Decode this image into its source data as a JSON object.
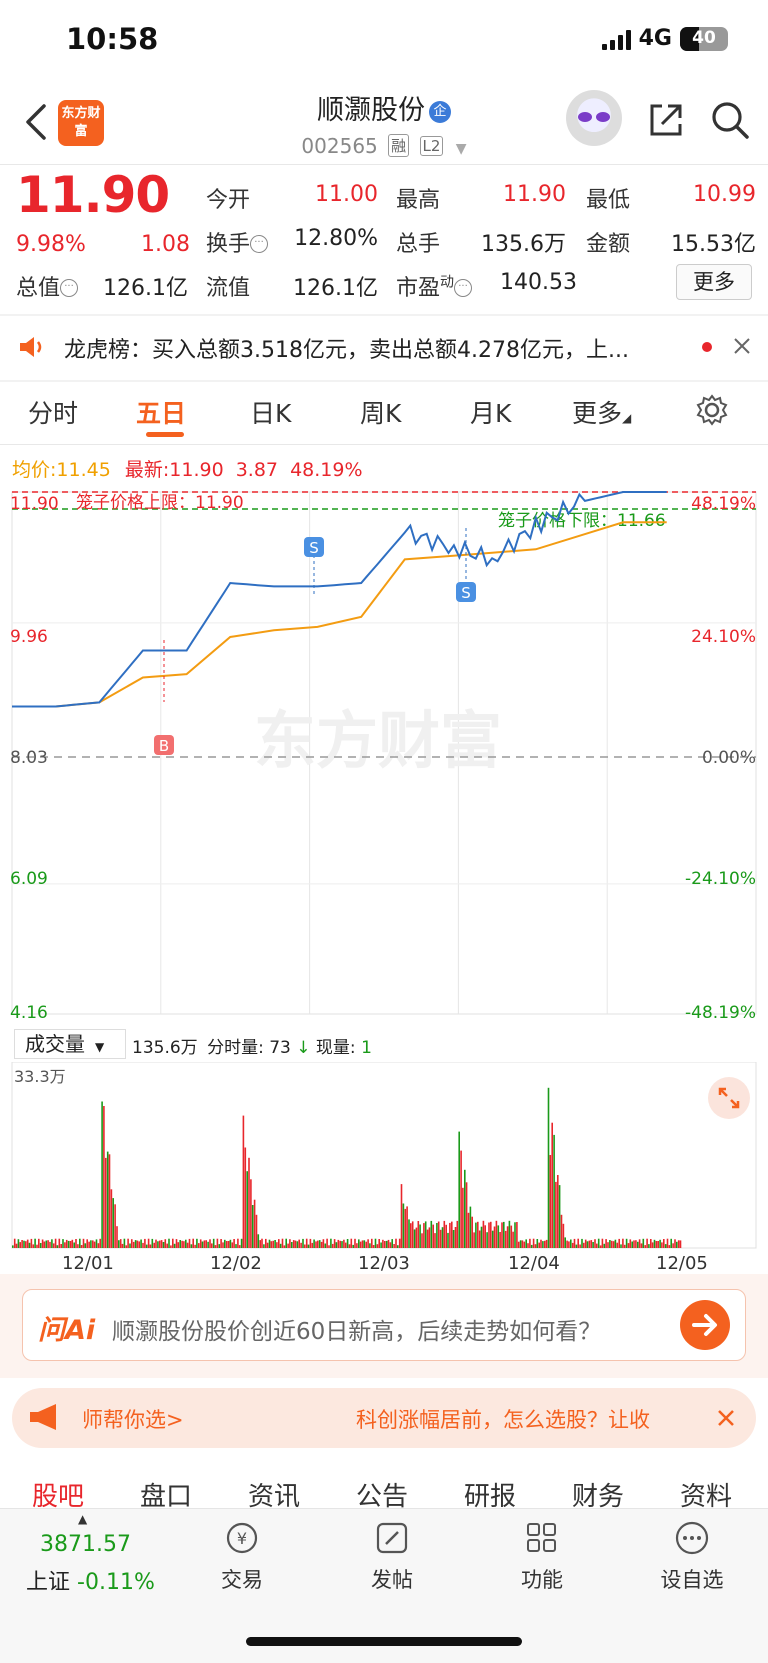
{
  "status": {
    "time": "10:58",
    "network": "4G",
    "battery": "40"
  },
  "header": {
    "logo": "东方财富",
    "stock_name": "顺灏股份",
    "cert_badge": "企",
    "stock_code": "002565",
    "tag_margin": "融",
    "tag_level": "L2"
  },
  "quote": {
    "price": "11.90",
    "change_pct": "9.98%",
    "change_amt": "1.08",
    "open_label": "今开",
    "open": "11.00",
    "high_label": "最高",
    "high": "11.90",
    "low_label": "最低",
    "low": "10.99",
    "turnover_label": "换手",
    "turnover": "12.80%",
    "volume_label": "总手",
    "volume": "135.6万",
    "amount_label": "金额",
    "amount": "15.53亿",
    "mktcap_label": "总值",
    "mktcap": "126.1亿",
    "float_label": "流值",
    "float_cap": "126.1亿",
    "pe_label": "市盈",
    "pe_sup": "动",
    "pe": "140.53",
    "more": "更多"
  },
  "notice": {
    "text": "龙虎榜：买入总额3.518亿元，卖出总额4.278亿元，上..."
  },
  "tabs": [
    "分时",
    "五日",
    "日K",
    "周K",
    "月K",
    "更多"
  ],
  "chart": {
    "avg_label": "均价:",
    "avg": "11.45",
    "last_label": "最新:",
    "last": "11.90",
    "last_chg": "3.87",
    "last_pct": "48.19%",
    "upper_limit_label": "笼子价格上限：11.90",
    "lower_limit_label": "笼子价格下限：11.66",
    "y_left": [
      "11.90",
      "9.96",
      "8.03",
      "6.09",
      "4.16"
    ],
    "y_right": [
      "48.19%",
      "24.10%",
      "0.00%",
      "-24.10%",
      "-48.19%"
    ],
    "watermark": "东方财富",
    "marker_b": "B",
    "marker_s": "S"
  },
  "volume": {
    "select": "成交量",
    "total": "135.6万",
    "minute_label": "分时量:",
    "minute": "73",
    "now_label": "现量:",
    "now": "1",
    "axis_top": "33.3万"
  },
  "dates": [
    "12/01",
    "12/02",
    "12/03",
    "12/04",
    "12/05"
  ],
  "chart_data": {
    "type": "line",
    "title": "",
    "x": [
      "12/01",
      "12/02",
      "12/03",
      "12/04",
      "12/05"
    ],
    "ylim": [
      4.16,
      11.9
    ],
    "series": [
      {
        "values": [
          8.72,
          8.72,
          8.78,
          9.55,
          9.55,
          10.55,
          10.5,
          10.5,
          10.55,
          11.3,
          11.1,
          10.9,
          11.4,
          11.75,
          11.9,
          11.9
        ]
      },
      {
        "values": [
          8.72,
          8.72,
          8.78,
          9.15,
          9.2,
          9.75,
          9.85,
          9.9,
          10.05,
          10.9,
          10.95,
          11.0,
          11.05,
          11.25,
          11.45,
          11.45
        ]
      }
    ],
    "volume_max": "33.3万"
  },
  "ai": {
    "logo": "问Ai",
    "text": "顺灏股份股价创近60日新高，后续走势如何看？"
  },
  "promo": {
    "left": "师帮你选>",
    "right": "科创涨幅居前，怎么选股？让收"
  },
  "bottom_tabs": [
    "股吧",
    "盘口",
    "资讯",
    "公告",
    "研报",
    "财务",
    "资料"
  ],
  "bottom_bar": {
    "index_value": "3871.57",
    "index_name": "上证",
    "index_chg": "-0.11%",
    "trade": "交易",
    "post": "发帖",
    "func": "功能",
    "watch": "设自选"
  }
}
